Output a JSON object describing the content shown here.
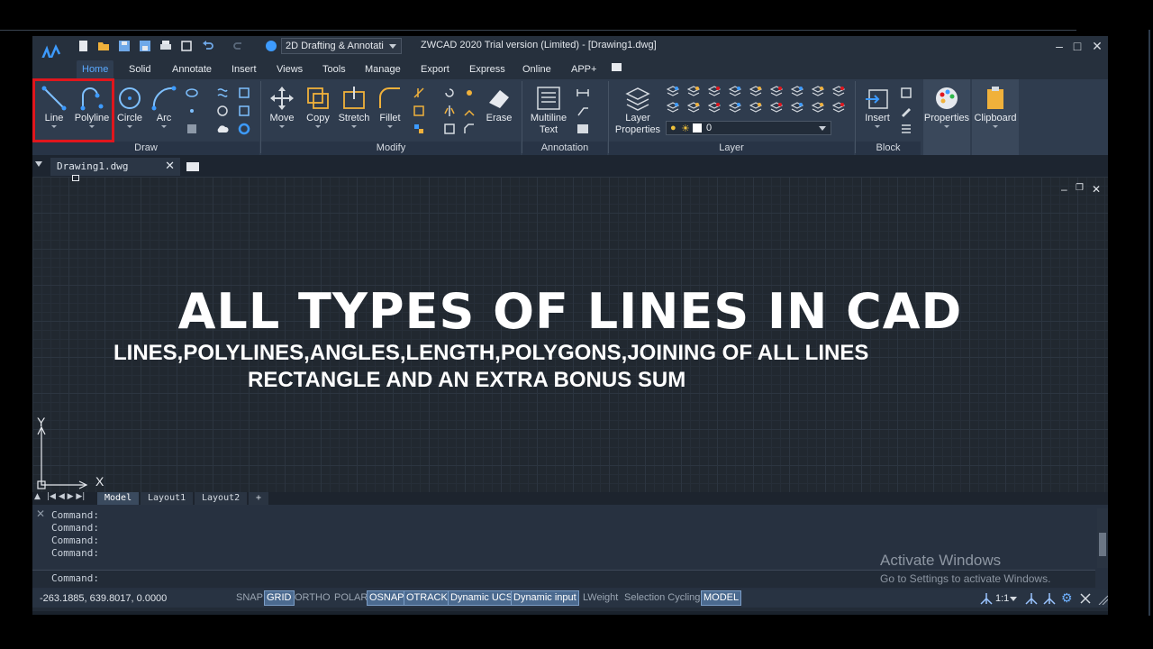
{
  "titlebar": {
    "workspace": "2D Drafting & Annotati",
    "title": "ZWCAD 2020 Trial version (Limited) - [Drawing1.dwg]"
  },
  "tabs": [
    "Home",
    "Solid",
    "Annotate",
    "Insert",
    "Views",
    "Tools",
    "Manage",
    "Export",
    "Express",
    "Online",
    "APP+"
  ],
  "ribbon": {
    "draw": {
      "line": "Line",
      "polyline": "Polyline",
      "circle": "Circle",
      "arc": "Arc",
      "panel": "Draw"
    },
    "modify": {
      "move": "Move",
      "copy": "Copy",
      "stretch": "Stretch",
      "fillet": "Fillet",
      "erase": "Erase",
      "panel": "Modify"
    },
    "annotation": {
      "mtext_1": "Multiline",
      "mtext_2": "Text",
      "panel": "Annotation"
    },
    "layer": {
      "props_1": "Layer",
      "props_2": "Properties",
      "current": "0",
      "panel": "Layer"
    },
    "block": {
      "insert": "Insert",
      "panel": "Block"
    },
    "properties": "Properties",
    "clipboard": "Clipboard"
  },
  "doc_tab": "Drawing1.dwg",
  "canvas": {
    "headline": "ALL TYPES OF LINES IN CAD",
    "subline1": "LINES,POLYLINES,ANGLES,LENGTH,POLYGONS,JOINING OF ALL LINES",
    "subline2": "RECTANGLE AND AN EXTRA BONUS SUM",
    "ucs_y": "Y",
    "ucs_x": "X"
  },
  "layout_tabs": [
    "Model",
    "Layout1",
    "Layout2",
    "+"
  ],
  "command": {
    "history": [
      "Command:",
      "Command:",
      "Command:",
      "Command:"
    ],
    "prompt": "Command:"
  },
  "watermark": {
    "line1": "Activate Windows",
    "line2": "Go to Settings to activate Windows."
  },
  "status": {
    "coords": "-263.1885, 639.8017, 0.0000",
    "toggles": [
      {
        "label": "SNAP",
        "on": false
      },
      {
        "label": "GRID",
        "on": true
      },
      {
        "label": "ORTHO",
        "on": false
      },
      {
        "label": "POLAR",
        "on": false
      },
      {
        "label": "OSNAP",
        "on": true
      },
      {
        "label": "OTRACK",
        "on": true
      },
      {
        "label": "Dynamic UCS",
        "on": true
      },
      {
        "label": "Dynamic input",
        "on": true
      },
      {
        "label": "LWeight",
        "on": false
      },
      {
        "label": "Selection Cycling",
        "on": false
      },
      {
        "label": "MODEL",
        "on": true
      }
    ],
    "scale": "1:1"
  },
  "colors": {
    "accent": "#5aa9ff",
    "highlight": "#e0161d",
    "canvas": "#212830"
  }
}
